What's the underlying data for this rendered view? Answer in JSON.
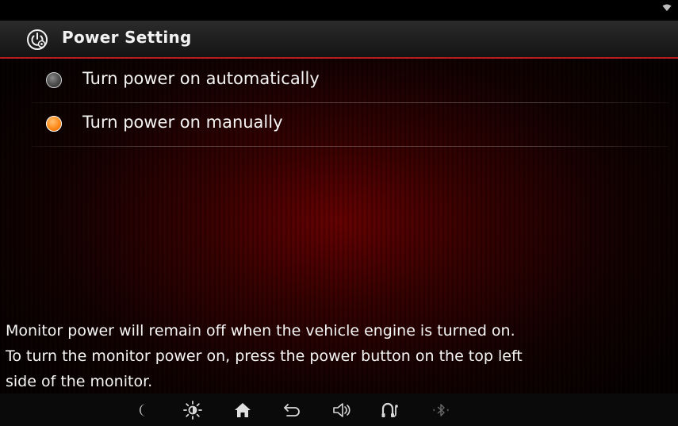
{
  "header": {
    "title": "Power Setting",
    "icon": "power-settings-icon"
  },
  "options": [
    {
      "label": "Turn power on automatically",
      "selected": false
    },
    {
      "label": "Turn power on manually",
      "selected": true
    }
  ],
  "message": {
    "line1": "Monitor power will remain off when the vehicle engine is turned on.",
    "line2": "To turn the monitor power on, press the power button on the top left",
    "line3": "side of the monitor."
  },
  "navbar": {
    "icons": [
      "night-mode-icon",
      "brightness-icon",
      "home-icon",
      "back-icon",
      "volume-icon",
      "phone-icon",
      "bluetooth-icon"
    ]
  },
  "colors": {
    "accent": "#ff8a1a",
    "header_rule": "#b81d1d",
    "background_glow": "#780000"
  }
}
